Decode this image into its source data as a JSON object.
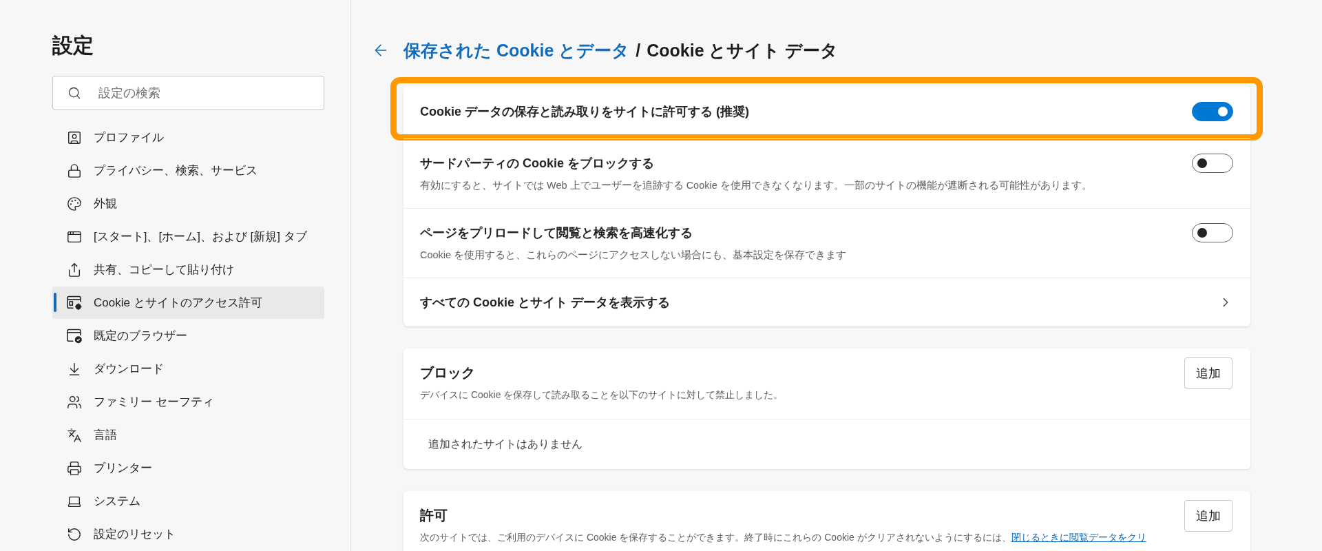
{
  "sidebar": {
    "title": "設定",
    "search": {
      "placeholder": "設定の検索"
    },
    "items": [
      {
        "label": "プロファイル",
        "selected": false
      },
      {
        "label": "プライバシー、検索、サービス",
        "selected": false
      },
      {
        "label": "外観",
        "selected": false
      },
      {
        "label": "[スタート]、[ホーム]、および [新規] タブ",
        "selected": false
      },
      {
        "label": "共有、コピーして貼り付け",
        "selected": false
      },
      {
        "label": "Cookie とサイトのアクセス許可",
        "selected": true
      },
      {
        "label": "既定のブラウザー",
        "selected": false
      },
      {
        "label": "ダウンロード",
        "selected": false
      },
      {
        "label": "ファミリー セーフティ",
        "selected": false
      },
      {
        "label": "言語",
        "selected": false
      },
      {
        "label": "プリンター",
        "selected": false
      },
      {
        "label": "システム",
        "selected": false
      },
      {
        "label": "設定のリセット",
        "selected": false
      }
    ]
  },
  "page_header": {
    "breadcrumb": [
      {
        "label": "保存された Cookie とデータ",
        "kind": "link"
      },
      {
        "label": "Cookie とサイト データ",
        "kind": "current"
      }
    ],
    "separator": "/"
  },
  "cookie_settings": [
    {
      "kind": "toggle",
      "label": "Cookie データの保存と読み取りをサイトに許可する (推奨)",
      "on": true,
      "highlighted": true
    },
    {
      "kind": "toggle",
      "label": "サードパーティの Cookie をブロックする",
      "description": "有効にすると、サイトでは Web 上でユーザーを追跡する Cookie を使用できなくなります。一部のサイトの機能が遮断される可能性があります。",
      "on": false,
      "highlighted": false
    },
    {
      "kind": "toggle",
      "label": "ページをプリロードして閲覧と検索を高速化する",
      "description": "Cookie を使用すると、これらのページにアクセスしない場合にも、基本設定を保存できます",
      "on": false,
      "highlighted": false
    },
    {
      "kind": "link",
      "label": "すべての Cookie とサイト データを表示する",
      "highlighted": false
    }
  ],
  "site_lists": [
    {
      "title": "ブロック",
      "description": "デバイスに Cookie を保存して読み取ることを以下のサイトに対して禁止しました。",
      "button": "追加",
      "empty_text": "追加されたサイトはありません"
    },
    {
      "title": "許可",
      "description": "次のサイトでは、ご利用のデバイスに Cookie を保存することができます。終了時にこれらの Cookie がクリアされないようにするには、",
      "link": "閉じるときに閲覧データをクリ",
      "button": "追加"
    }
  ]
}
